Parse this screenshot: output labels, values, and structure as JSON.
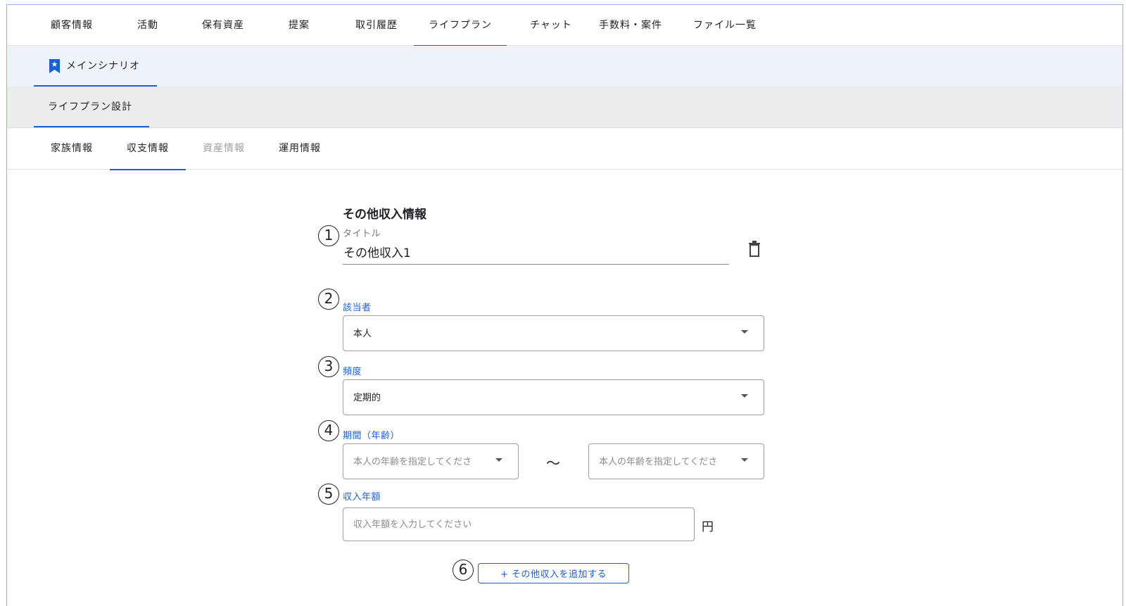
{
  "top_nav": {
    "tabs": [
      {
        "label": "顧客情報"
      },
      {
        "label": "活動"
      },
      {
        "label": "保有資産"
      },
      {
        "label": "提案"
      },
      {
        "label": "取引履歴"
      },
      {
        "label": "ライフプラン",
        "active": true
      },
      {
        "label": "チャット"
      },
      {
        "label": "手数料・案件"
      },
      {
        "label": "ファイル一覧"
      }
    ]
  },
  "scenario": {
    "label": "メインシナリオ",
    "icon": "bookmark-star-icon"
  },
  "design": {
    "label": "ライフプラン設計"
  },
  "sub_nav": {
    "tabs": [
      {
        "label": "家族情報"
      },
      {
        "label": "収支情報",
        "active": true
      },
      {
        "label": "資産情報",
        "disabled": true
      },
      {
        "label": "運用情報"
      }
    ]
  },
  "form": {
    "section_title": "その他収入情報",
    "markers": [
      "1",
      "2",
      "3",
      "4",
      "5",
      "6"
    ],
    "title_field": {
      "label": "タイトル",
      "value": "その他収入1"
    },
    "person_field": {
      "label": "該当者",
      "value": "本人"
    },
    "frequency_field": {
      "label": "頻度",
      "value": "定期的"
    },
    "period_field": {
      "label": "期間（年齢）",
      "from_placeholder": "本人の年齢を指定してくださ",
      "to_placeholder": "本人の年齢を指定してくださ",
      "separator": "〜"
    },
    "amount_field": {
      "label": "収入年額",
      "placeholder": "収入年額を入力してください",
      "unit": "円"
    },
    "add_button": "+ その他収入を追加する"
  },
  "colors": {
    "accent": "#1a5fd6",
    "tab_bar_bg": "#eef3fb",
    "design_bar_bg": "#ececec"
  }
}
